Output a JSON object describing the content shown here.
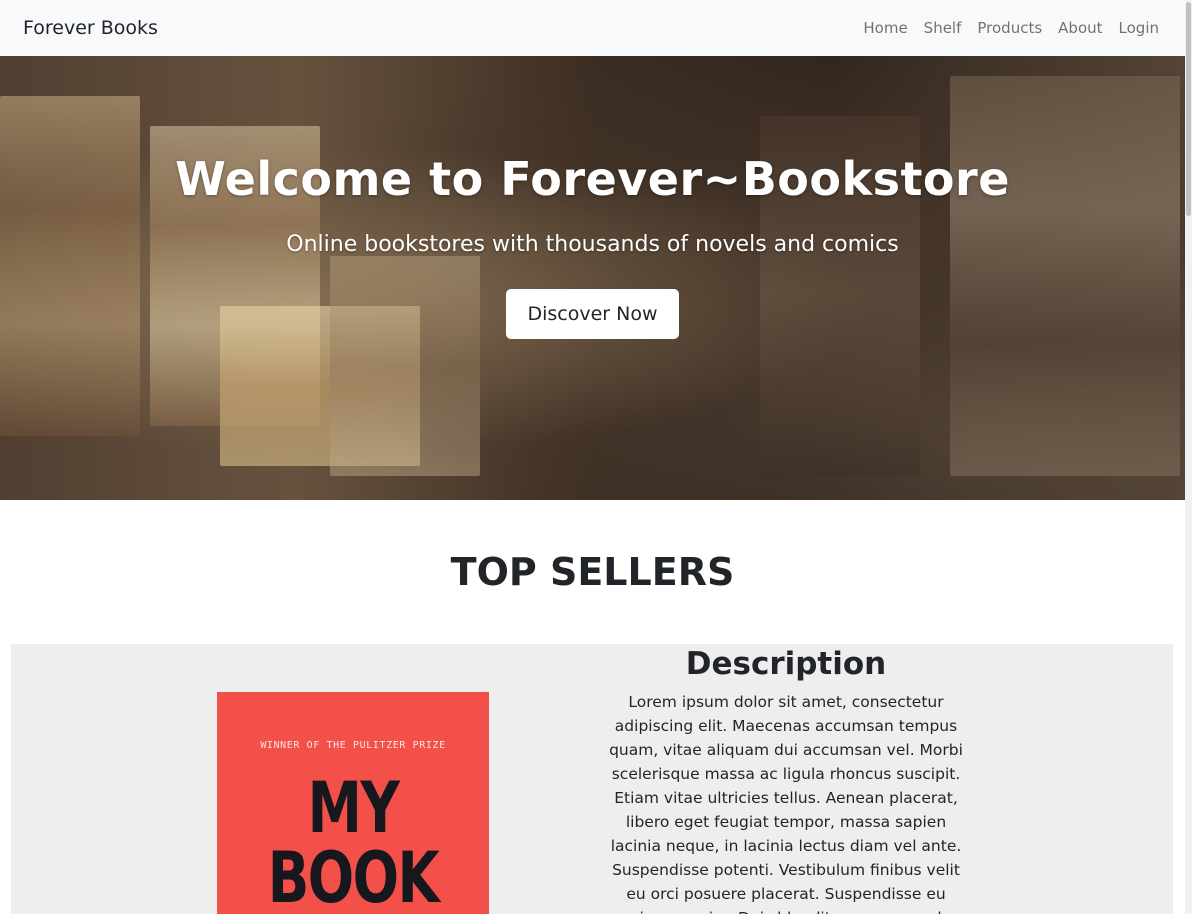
{
  "navbar": {
    "brand": "Forever Books",
    "links": [
      "Home",
      "Shelf",
      "Products",
      "About",
      "Login"
    ]
  },
  "hero": {
    "title": "Welcome to Forever~Bookstore",
    "subtitle": "Online bookstores with thousands of novels and comics",
    "button_label": "Discover Now"
  },
  "top_sellers": {
    "heading": "TOP SELLERS",
    "book": {
      "cover_kicker": "WINNER OF THE PULITZER PRIZE",
      "cover_title_line1": "MY",
      "cover_title_line2": "BOOK",
      "cover_color": "#f4504a"
    },
    "description_heading": "Description",
    "description_text": "Lorem ipsum dolor sit amet, consectetur adipiscing elit. Maecenas accumsan tempus quam, vitae aliquam dui accumsan vel. Morbi scelerisque massa ac ligula rhoncus suscipit. Etiam vitae ultricies tellus. Aenean placerat, libero eget feugiat tempor, massa sapien lacinia neque, in lacinia lectus diam vel ante. Suspendisse potenti. Vestibulum finibus velit eu orci posuere placerat. Suspendisse eu viverra enim. Duis blandit non purus vel dictum."
  }
}
